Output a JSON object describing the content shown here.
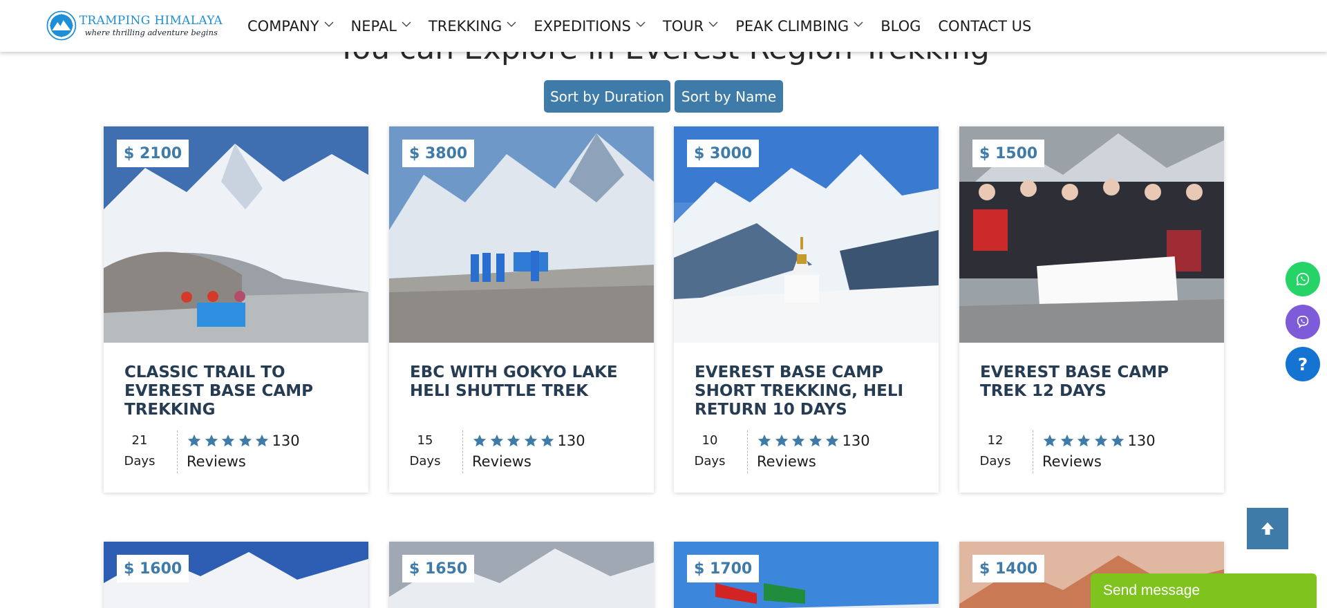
{
  "brand": {
    "name": "TRAMPING HIMALAYA",
    "tagline": "where thrilling adventure begins"
  },
  "nav": [
    {
      "label": "COMPANY",
      "has_dropdown": true
    },
    {
      "label": "NEPAL",
      "has_dropdown": true
    },
    {
      "label": "TREKKING",
      "has_dropdown": true
    },
    {
      "label": "EXPEDITIONS",
      "has_dropdown": true
    },
    {
      "label": "TOUR",
      "has_dropdown": true
    },
    {
      "label": "PEAK CLIMBING",
      "has_dropdown": true
    },
    {
      "label": "BLOG",
      "has_dropdown": false
    },
    {
      "label": "CONTACT US",
      "has_dropdown": false
    }
  ],
  "section": {
    "heading": "You can Explore in Everest Region Trekking"
  },
  "sort": {
    "duration_label": "Sort by Duration",
    "name_label": "Sort by Name"
  },
  "cards": [
    {
      "price": "$ 2100",
      "title": "CLASSIC TRAIL TO EVEREST BASE CAMP TREKKING",
      "days": "21",
      "days_label": "Days",
      "rating": 5,
      "reviews": "130",
      "reviews_label": "Reviews"
    },
    {
      "price": "$ 3800",
      "title": "EBC WITH GOKYO LAKE HELI SHUTTLE TREK",
      "days": "15",
      "days_label": "Days",
      "rating": 5,
      "reviews": "130",
      "reviews_label": "Reviews"
    },
    {
      "price": "$ 3000",
      "title": "EVEREST BASE CAMP SHORT TREKKING, HELI RETURN 10 DAYS",
      "days": "10",
      "days_label": "Days",
      "rating": 5,
      "reviews": "130",
      "reviews_label": "Reviews"
    },
    {
      "price": "$ 1500",
      "title": "EVEREST BASE CAMP TREK 12 DAYS",
      "days": "12",
      "days_label": "Days",
      "rating": 5,
      "reviews": "130",
      "reviews_label": "Reviews"
    },
    {
      "price": "$ 1600"
    },
    {
      "price": "$ 1650"
    },
    {
      "price": "$ 1700"
    },
    {
      "price": "$ 1400"
    }
  ],
  "floating": {
    "help_label": "?",
    "send_message": "Send message"
  },
  "icons": [
    "whatsapp-icon",
    "viber-icon",
    "help-icon",
    "arrow-up-icon",
    "star-icon",
    "chevron-down-icon"
  ],
  "colors": {
    "accent": "#3e7ba8",
    "whatsapp": "#25d366",
    "viber": "#7d5bd9",
    "help": "#1574d1",
    "send": "#7fc31f"
  }
}
